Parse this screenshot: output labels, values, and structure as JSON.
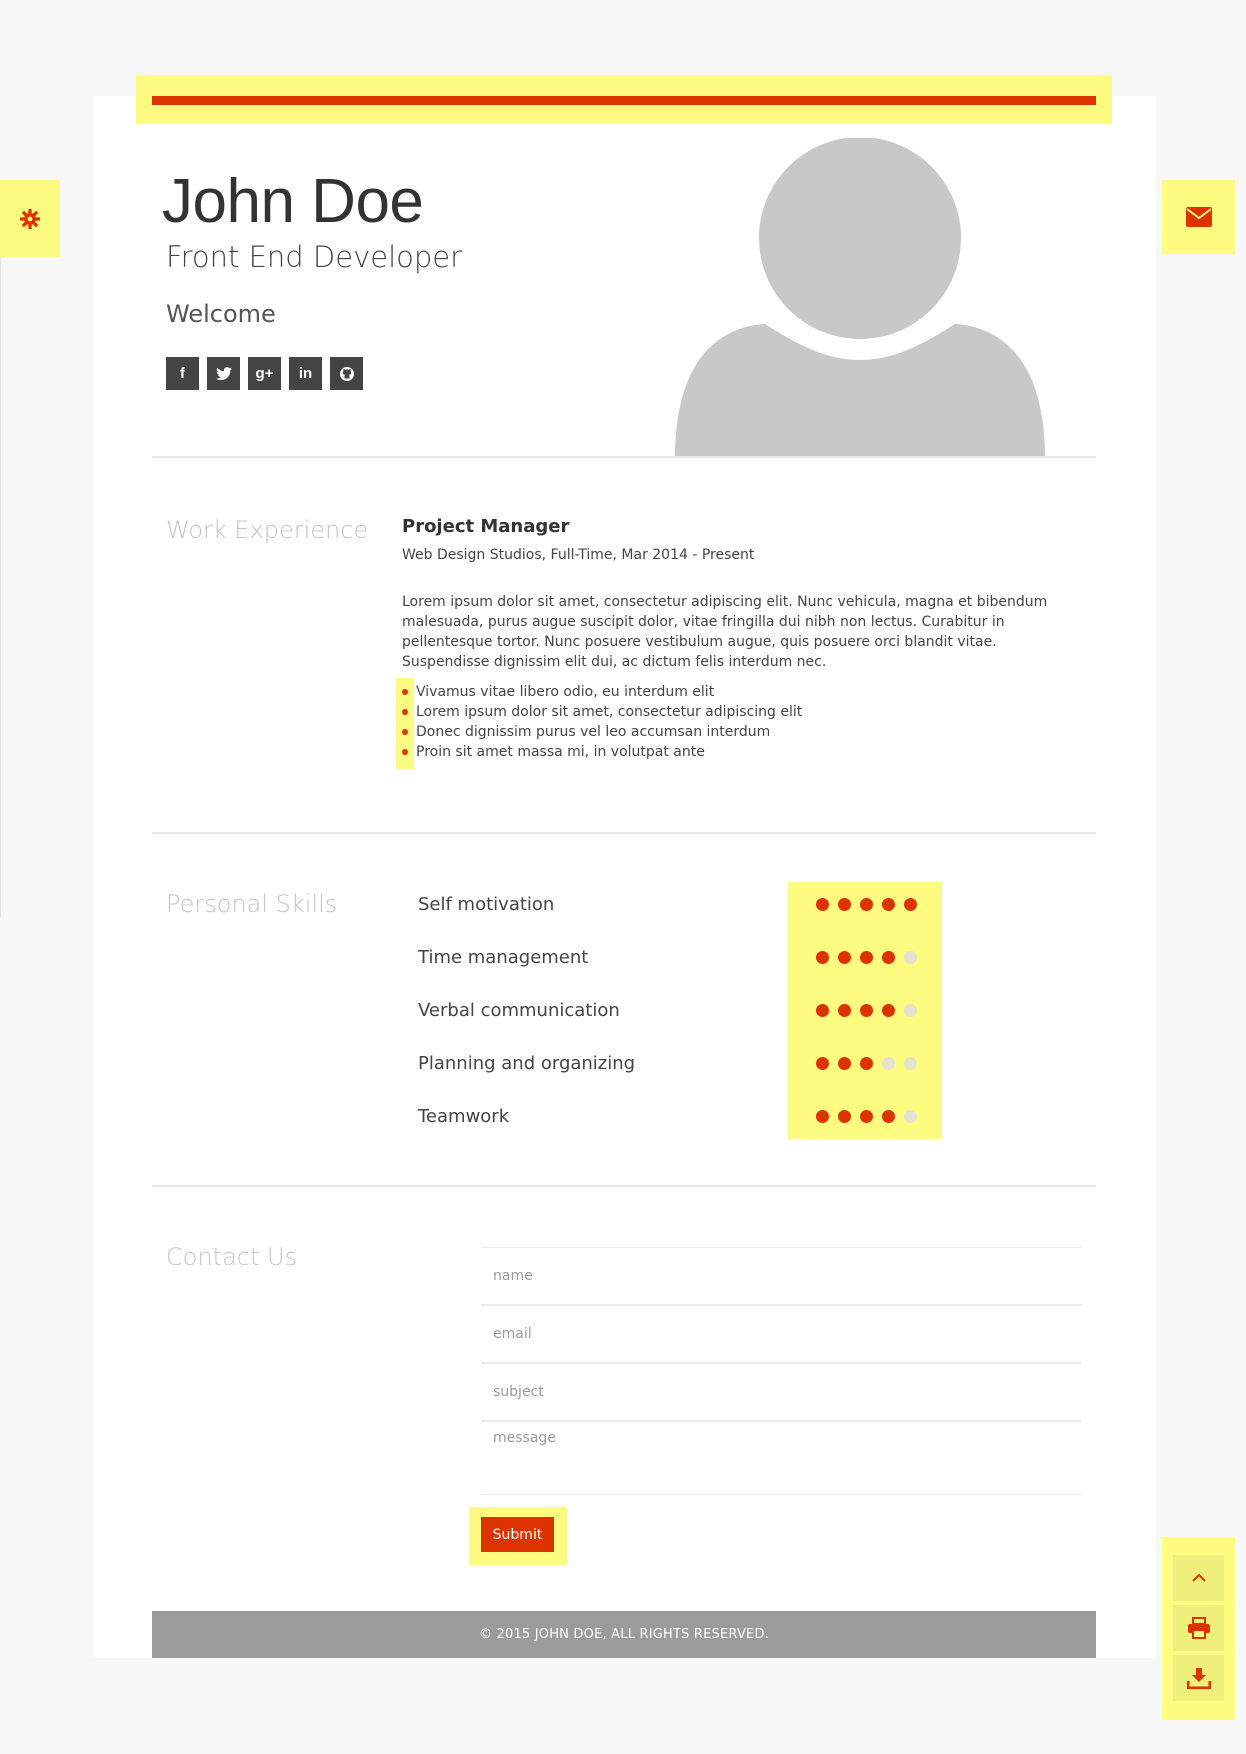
{
  "header": {
    "name": "John Doe",
    "role": "Front End Developer",
    "welcome": "Welcome",
    "socials": [
      {
        "icon": "facebook-icon",
        "glyph": "f"
      },
      {
        "icon": "twitter-icon",
        "glyph": "t"
      },
      {
        "icon": "google-plus-icon",
        "glyph": "g+"
      },
      {
        "icon": "linkedin-icon",
        "glyph": "in"
      },
      {
        "icon": "github-icon",
        "glyph": "gh"
      }
    ]
  },
  "work": {
    "section_title": "Work Experience",
    "job_title": "Project Manager",
    "job_meta": "Web Design Studios, Full-Time, Mar 2014 - Present",
    "description": "Lorem ipsum dolor sit amet, consectetur adipiscing elit. Nunc vehicula, magna et bibendum malesuada, purus augue suscipit dolor, vitae fringilla dui nibh non lectus. Curabitur in pellentesque tortor. Nunc posuere vestibulum augue, quis posuere orci blandit vitae. Suspendisse dignissim elit dui, ac dictum felis interdum nec.",
    "bullets": [
      "Vivamus vitae libero odio, eu interdum elit",
      "Lorem ipsum dolor sit amet, consectetur adipiscing elit",
      "Donec dignissim purus vel leo accumsan interdum",
      "Proin sit amet massa mi, in volutpat ante"
    ]
  },
  "skills": {
    "section_title": "Personal Skills",
    "max_rating": 5,
    "items": [
      {
        "name": "Self motivation",
        "rating": 5
      },
      {
        "name": "Time management",
        "rating": 4
      },
      {
        "name": "Verbal communication",
        "rating": 4
      },
      {
        "name": "Planning and organizing",
        "rating": 3
      },
      {
        "name": "Teamwork",
        "rating": 4
      }
    ]
  },
  "contact": {
    "section_title": "Contact Us",
    "placeholders": {
      "name": "name",
      "email": "email",
      "subject": "subject",
      "message": "message"
    },
    "submit_label": "Submit"
  },
  "footer": {
    "text": "© 2015 JOHN DOE, ALL RIGHTS RESERVED."
  },
  "colors": {
    "accent": "#dd3300",
    "highlight": "#fdfb80",
    "footer_bg": "#9b9b9b"
  },
  "tools": {
    "settings_icon": "gear-icon",
    "mail_icon": "envelope-icon",
    "floating": [
      "chevron-up-icon",
      "printer-icon",
      "download-icon"
    ]
  }
}
